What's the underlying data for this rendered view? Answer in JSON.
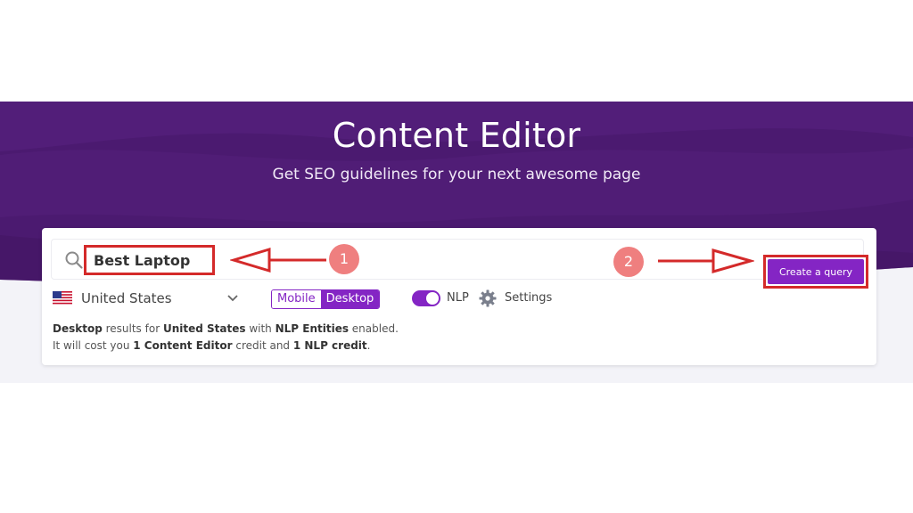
{
  "hero": {
    "title": "Content Editor",
    "subtitle": "Get SEO guidelines for your next awesome page"
  },
  "search": {
    "value": "Best Laptop",
    "icon": "search-icon"
  },
  "annotations": {
    "step1": "1",
    "step2": "2"
  },
  "create_button": {
    "label": "Create a query"
  },
  "options": {
    "country": "United States",
    "devices": [
      "Mobile",
      "Desktop"
    ],
    "selected_device": "Desktop",
    "nlp_label": "NLP",
    "nlp_enabled": true,
    "settings_label": "Settings"
  },
  "info": {
    "device": "Desktop",
    "text1": " results for ",
    "country": "United States",
    "text2": " with ",
    "nlp": "NLP Entities",
    "text3": " enabled.",
    "text4": "It will cost you ",
    "credit1": "1 Content Editor",
    "text5": " credit and ",
    "credit2": "1 NLP credit",
    "text6": "."
  },
  "colors": {
    "brand_purple": "#8425c4",
    "hero_purple": "#4a1a6e",
    "annotation_red": "#d42a2a",
    "badge_pink": "#ef7f7f"
  }
}
